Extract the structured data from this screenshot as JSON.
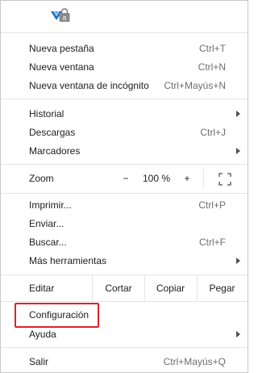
{
  "extensions": [
    "vivaldi-icon",
    "shopping-bag-icon"
  ],
  "section1": [
    {
      "label": "Nueva pestaña",
      "shortcut": "Ctrl+T"
    },
    {
      "label": "Nueva ventana",
      "shortcut": "Ctrl+N"
    },
    {
      "label": "Nueva ventana de incógnito",
      "shortcut": "Ctrl+Mayús+N"
    }
  ],
  "section2": [
    {
      "label": "Historial",
      "shortcut": ""
    },
    {
      "label": "Descargas",
      "shortcut": "Ctrl+J"
    },
    {
      "label": "Marcadores",
      "shortcut": ""
    }
  ],
  "zoom": {
    "label": "Zoom",
    "minus": "−",
    "value": "100 %",
    "plus": "+"
  },
  "section3": [
    {
      "label": "Imprimir...",
      "shortcut": "Ctrl+P"
    },
    {
      "label": "Enviar...",
      "shortcut": ""
    },
    {
      "label": "Buscar...",
      "shortcut": "Ctrl+F"
    },
    {
      "label": "Más herramientas",
      "shortcut": ""
    }
  ],
  "edit": {
    "label": "Editar",
    "cut": "Cortar",
    "copy": "Copiar",
    "paste": "Pegar"
  },
  "section4": [
    {
      "label": "Configuración",
      "shortcut": ""
    },
    {
      "label": "Ayuda",
      "shortcut": ""
    }
  ],
  "section5": [
    {
      "label": "Salir",
      "shortcut": "Ctrl+Mayús+Q"
    }
  ],
  "colors": {
    "highlight": "#e0212a",
    "vivaldi_blue": "#1a73c8",
    "bag_gray": "#777777"
  }
}
